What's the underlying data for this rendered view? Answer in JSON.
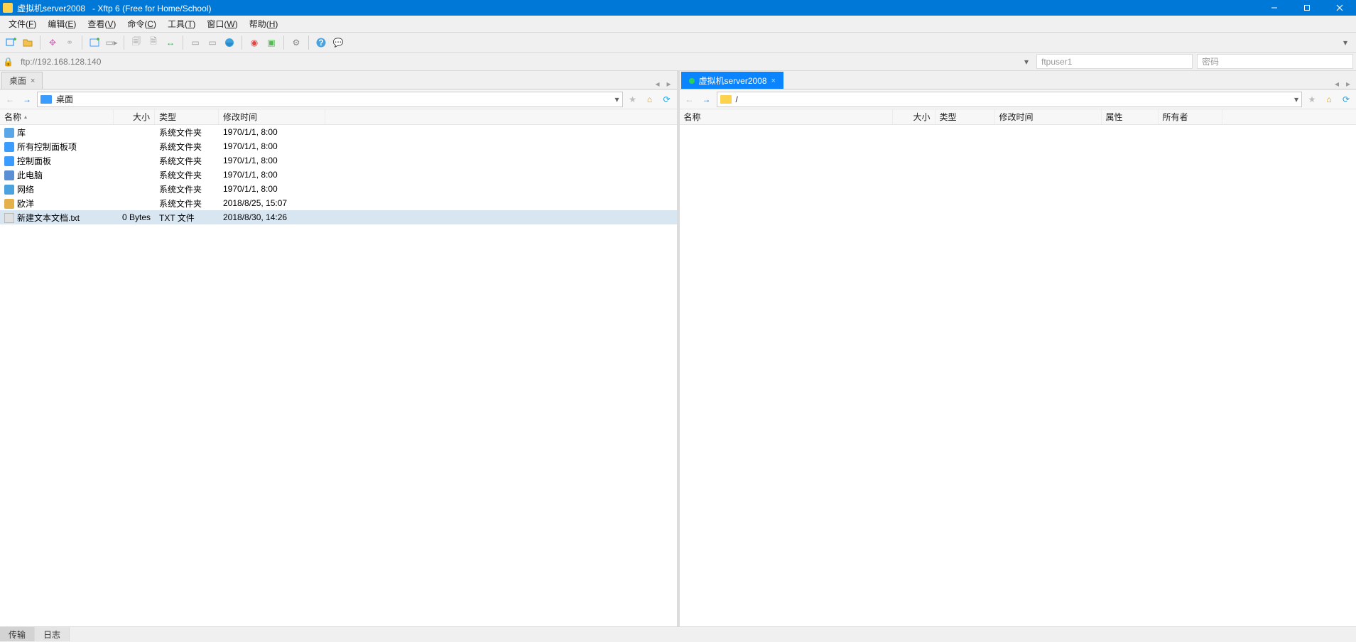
{
  "title": {
    "session": "虚拟机server2008",
    "app": "   - Xftp 6 (Free for Home/School)"
  },
  "menus": [
    {
      "label": "文件",
      "accel": "F"
    },
    {
      "label": "编辑",
      "accel": "E"
    },
    {
      "label": "查看",
      "accel": "V"
    },
    {
      "label": "命令",
      "accel": "C"
    },
    {
      "label": "工具",
      "accel": "T"
    },
    {
      "label": "窗口",
      "accel": "W"
    },
    {
      "label": "帮助",
      "accel": "H"
    }
  ],
  "address": {
    "url": "ftp://192.168.128.140",
    "user": "ftpuser1",
    "password_placeholder": "密码"
  },
  "left": {
    "tab": "桌面",
    "path": "桌面",
    "columns": {
      "name": "名称",
      "size": "大小",
      "type": "类型",
      "mtime": "修改时间"
    },
    "colw": {
      "name": 160,
      "size": 58,
      "type": 90,
      "mtime": 150
    },
    "rows": [
      {
        "icon": "ic-lib",
        "name": "库",
        "size": "",
        "type": "系统文件夹",
        "mtime": "1970/1/1, 8:00"
      },
      {
        "icon": "ic-panel",
        "name": "所有控制面板项",
        "size": "",
        "type": "系统文件夹",
        "mtime": "1970/1/1, 8:00"
      },
      {
        "icon": "ic-ctrl",
        "name": "控制面板",
        "size": "",
        "type": "系统文件夹",
        "mtime": "1970/1/1, 8:00"
      },
      {
        "icon": "ic-pc",
        "name": "此电脑",
        "size": "",
        "type": "系统文件夹",
        "mtime": "1970/1/1, 8:00"
      },
      {
        "icon": "ic-net",
        "name": "网络",
        "size": "",
        "type": "系统文件夹",
        "mtime": "1970/1/1, 8:00"
      },
      {
        "icon": "ic-user",
        "name": "欧洋",
        "size": "",
        "type": "系统文件夹",
        "mtime": "2018/8/25, 15:07"
      },
      {
        "icon": "ic-txt",
        "name": "新建文本文档.txt",
        "size": "0 Bytes",
        "type": "TXT 文件",
        "mtime": "2018/8/30, 14:26",
        "selected": true
      }
    ]
  },
  "right": {
    "tab": "虚拟机server2008",
    "path": "/",
    "columns": {
      "name": "名称",
      "size": "大小",
      "type": "类型",
      "mtime": "修改时间",
      "attr": "属性",
      "owner": "所有者"
    },
    "colw": {
      "name": 300,
      "size": 60,
      "type": 84,
      "mtime": 150,
      "attr": 80,
      "owner": 90
    },
    "rows": []
  },
  "bottom": {
    "tab1": "传输",
    "tab2": "日志"
  }
}
